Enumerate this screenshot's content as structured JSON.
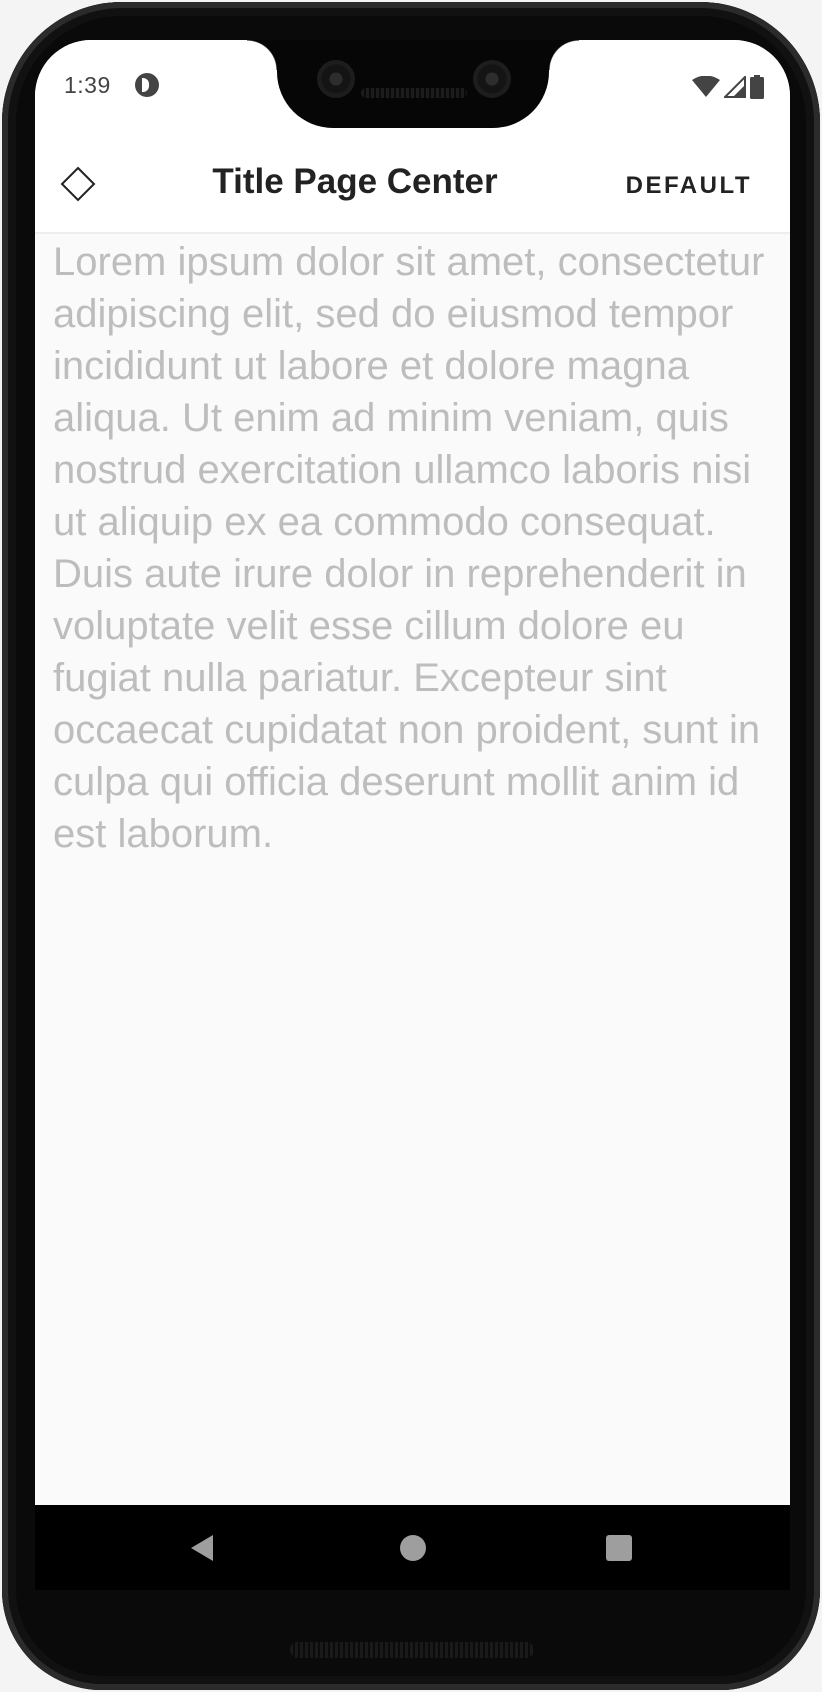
{
  "status_bar": {
    "time": "1:39",
    "app_icon": "app-notification-icon",
    "icons": [
      "wifi-icon",
      "cell-signal-icon",
      "battery-icon"
    ]
  },
  "app_bar": {
    "leading_icon": "diamond-outline-icon",
    "title": "Title Page Center",
    "action_label": "DEFAULT"
  },
  "content": {
    "text": "Lorem ipsum dolor sit amet, consectetur adipiscing elit, sed do eiusmod tempor incididunt ut labore et dolore magna aliqua. Ut enim ad minim veniam, quis nostrud exercitation ullamco laboris nisi ut aliquip ex ea commodo consequat. Duis aute irure dolor in reprehenderit in voluptate velit esse cillum dolore eu fugiat nulla pariatur. Excepteur sint occaecat cupidatat non proident, sunt in culpa qui officia deserunt mollit anim id est laborum."
  },
  "nav_bar": {
    "buttons": [
      "back-icon",
      "home-icon",
      "recents-icon"
    ]
  },
  "colors": {
    "app_bar_background": "#ffffff",
    "page_background": "#fafafa",
    "body_text": "#bdbdbd",
    "title_text": "#222222",
    "nav_bar_background": "#000000"
  }
}
